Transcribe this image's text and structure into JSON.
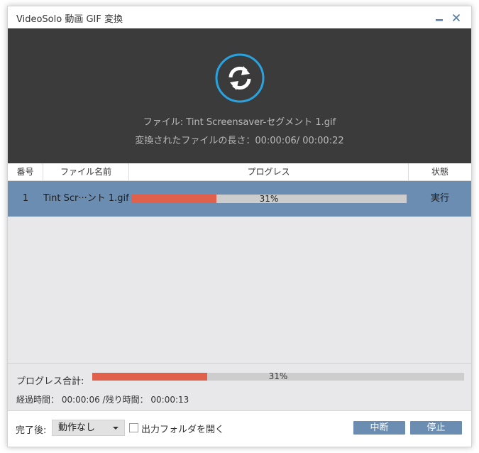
{
  "window": {
    "title": "VideoSolo 動画 GIF 変換",
    "minimize_icon": "minimize-icon",
    "close_icon": "close-icon"
  },
  "preview": {
    "icon": "refresh-convert-icon",
    "file_line": "ファイル: Tint Screensaver-セグメント 1.gif",
    "length_line": "変換されたファイルの長さ：00:00:06/ 00:00:22"
  },
  "table": {
    "headers": {
      "no": "番号",
      "name": "ファイル名前",
      "progress": "プログレス",
      "state": "状態"
    },
    "rows": [
      {
        "no": "1",
        "name": "Tint Scr···ント 1.gif",
        "progress": 0.31,
        "progress_text": "31%",
        "state": "実行"
      }
    ]
  },
  "summary": {
    "label": "プログレス合計:",
    "progress": 0.31,
    "progress_text": "31%",
    "time_line": "経過時間： 00:00:06 /残り時間： 00:00:13"
  },
  "footer": {
    "after_label": "完了後:",
    "after_value": "動作なし",
    "open_folder_label": "出力フォルダを開く",
    "open_folder_checked": false,
    "pause_label": "中断",
    "stop_label": "停止"
  },
  "colors": {
    "accent": "#6b8db2",
    "progress_fill": "#e0604c",
    "icon_ring": "#29a3e0"
  }
}
